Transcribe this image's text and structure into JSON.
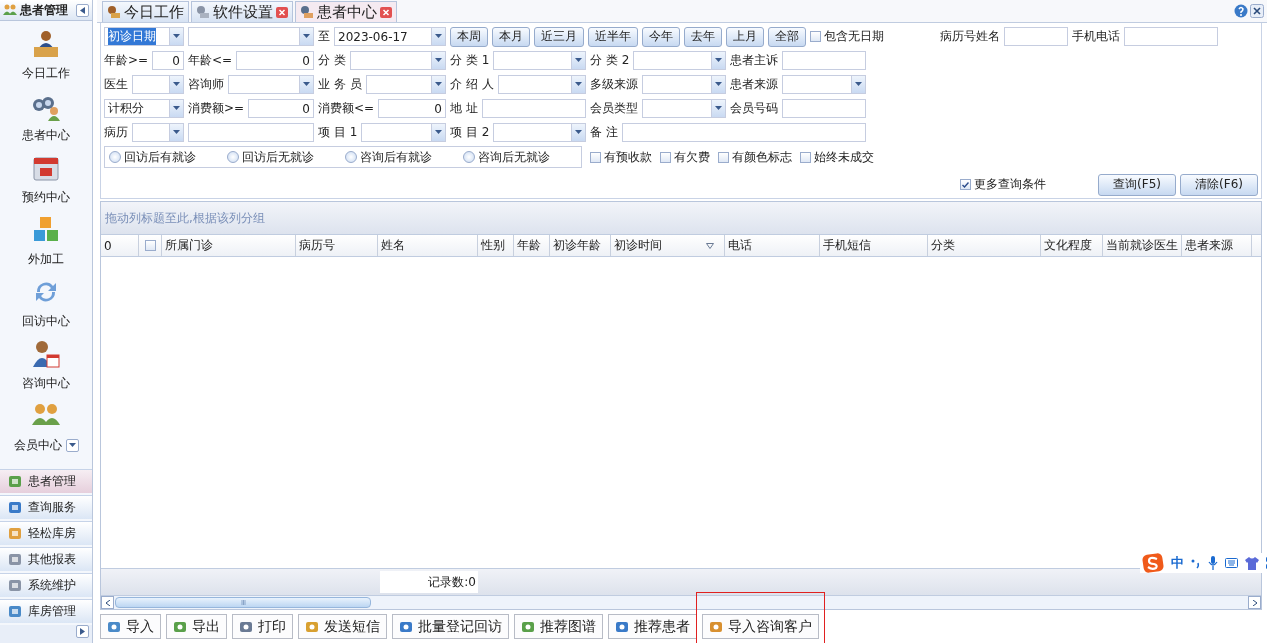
{
  "sidebar": {
    "title": "患者管理",
    "modules": [
      {
        "label": "今日工作"
      },
      {
        "label": "患者中心"
      },
      {
        "label": "预约中心"
      },
      {
        "label": "外加工"
      },
      {
        "label": "回访中心"
      },
      {
        "label": "咨询中心"
      },
      {
        "label": "会员中心"
      }
    ],
    "sections": [
      {
        "label": "患者管理",
        "selected": true
      },
      {
        "label": "查询服务",
        "selected": false
      },
      {
        "label": "轻松库房",
        "selected": false
      },
      {
        "label": "其他报表",
        "selected": false
      },
      {
        "label": "系统维护",
        "selected": false
      },
      {
        "label": "库房管理",
        "selected": false
      }
    ]
  },
  "tabs": [
    {
      "label": "今日工作",
      "selected": false,
      "closable": false
    },
    {
      "label": "软件设置",
      "selected": false,
      "closable": true
    },
    {
      "label": "患者中心",
      "selected": true,
      "closable": true
    }
  ],
  "date_row": {
    "date_field": {
      "value": "初诊日期",
      "text_selected": true
    },
    "to_label": "至",
    "range_end": "2023-06-17",
    "quick_buttons": [
      "本周",
      "本月",
      "近三月",
      "近半年",
      "今年",
      "去年",
      "上月",
      "全部"
    ],
    "include_undated": {
      "label": "包含无日期",
      "checked": false
    },
    "search_fields": [
      {
        "label": "病历号姓名"
      },
      {
        "label": "手机电话"
      }
    ]
  },
  "filter_rows": [
    [
      {
        "kind": "number",
        "label": "年龄>=",
        "value": "0"
      },
      {
        "kind": "number",
        "label": "年龄<=",
        "value": "0"
      },
      {
        "kind": "select",
        "label": "分 类"
      },
      {
        "kind": "select",
        "label": "分 类 1"
      },
      {
        "kind": "select",
        "label": "分 类 2"
      },
      {
        "kind": "text",
        "label": "患者主诉"
      }
    ],
    [
      {
        "kind": "select",
        "label": "医生"
      },
      {
        "kind": "select",
        "label": "咨询师"
      },
      {
        "kind": "select",
        "label": "业 务 员"
      },
      {
        "kind": "select",
        "label": "介 绍 人"
      },
      {
        "kind": "select",
        "label": "多级来源"
      },
      {
        "kind": "select",
        "label": "患者来源"
      }
    ],
    [
      {
        "kind": "select",
        "value": "计积分"
      },
      {
        "kind": "number",
        "label": "消费额>=",
        "value": "0"
      },
      {
        "kind": "number",
        "label": "消费额<=",
        "value": "0"
      },
      {
        "kind": "text",
        "label": "地 址"
      },
      {
        "kind": "select",
        "label": "会员类型"
      },
      {
        "kind": "text",
        "label": "会员号码"
      }
    ],
    [
      {
        "kind": "select",
        "label": "病历"
      },
      {
        "kind": "text"
      },
      {
        "kind": "select",
        "label": "项 目 1"
      },
      {
        "kind": "select",
        "label": "项 目 2"
      },
      {
        "kind": "memo",
        "label": "备 注"
      }
    ]
  ],
  "visit_options": [
    {
      "label": "回访后有就诊",
      "selected": false
    },
    {
      "label": "回访后无就诊",
      "selected": false
    },
    {
      "label": "咨询后有就诊",
      "selected": false
    },
    {
      "label": "咨询后无就诊",
      "selected": false
    }
  ],
  "flags": [
    {
      "label": "有预收款",
      "checked": false
    },
    {
      "label": "有欠费",
      "checked": false
    },
    {
      "label": "有颜色标志",
      "checked": false
    },
    {
      "label": "始终未成交",
      "checked": false
    }
  ],
  "more_conditions": {
    "label": "更多查询条件",
    "checked": true
  },
  "actions": [
    "查询(F5)",
    "清除(F6)"
  ],
  "grid": {
    "group_hint": "拖动列标题至此,根据该列分组",
    "columns": [
      {
        "kind": "text",
        "label": "0"
      },
      {
        "kind": "checkbox",
        "checked": false
      },
      {
        "kind": "text",
        "label": "所属门诊"
      },
      {
        "kind": "text",
        "label": "病历号"
      },
      {
        "kind": "text",
        "label": "姓名"
      },
      {
        "kind": "text",
        "label": "性别"
      },
      {
        "kind": "text",
        "label": "年龄"
      },
      {
        "kind": "text",
        "label": "初诊年龄"
      },
      {
        "kind": "filter",
        "label": "初诊时间"
      },
      {
        "kind": "text",
        "label": "电话"
      },
      {
        "kind": "text",
        "label": "手机短信"
      },
      {
        "kind": "text",
        "label": "分类"
      },
      {
        "kind": "text",
        "label": "文化程度"
      },
      {
        "kind": "text",
        "label": "当前就诊医生"
      },
      {
        "kind": "text",
        "label": "患者来源"
      }
    ],
    "record_count": "记录数:0"
  },
  "toolbar": [
    {
      "label": "导入",
      "highlighted": false
    },
    {
      "label": "导出",
      "highlighted": false
    },
    {
      "label": "打印",
      "highlighted": false
    },
    {
      "label": "发送短信",
      "highlighted": false
    },
    {
      "label": "批量登记回访",
      "highlighted": false
    },
    {
      "label": "推荐图谱",
      "highlighted": false
    },
    {
      "label": "推荐患者",
      "highlighted": false
    },
    {
      "label": "导入咨询客户",
      "highlighted": true
    }
  ],
  "ime_bar": {
    "label": "中"
  }
}
